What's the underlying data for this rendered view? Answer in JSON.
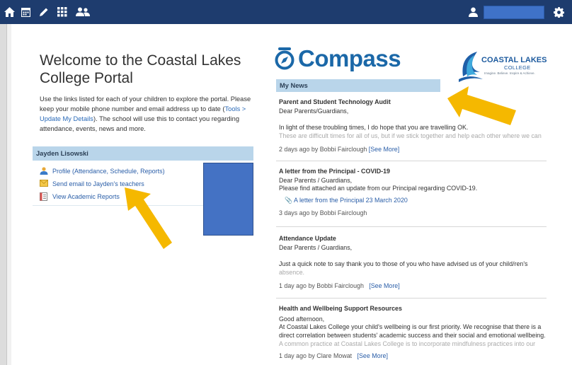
{
  "topbar": {
    "icons": [
      "home-icon",
      "calendar-icon",
      "pencil-icon",
      "grid-icon",
      "people-icon",
      "user-icon",
      "gear-icon"
    ]
  },
  "welcome": {
    "title": "Welcome to the Coastal Lakes College Portal",
    "intro_1": "Use the links listed for each of your children to explore the portal. Please keep your mobile phone number and email address up to date (",
    "intro_link": "Tools > Update My Details",
    "intro_2": "). The school will use this to contact you regarding attendance, events, news and more."
  },
  "student": {
    "name": "Jayden Lisowski",
    "links": [
      {
        "label": "Profile (Attendance, Schedule, Reports)",
        "icon": "profile-icon"
      },
      {
        "label": "Send email to Jayden's teachers",
        "icon": "email-icon"
      },
      {
        "label": "View Academic Reports",
        "icon": "report-icon"
      }
    ]
  },
  "logos": {
    "compass": "Compass",
    "school_name": "COASTAL LAKES",
    "school_sub": "COLLEGE",
    "school_tagline": "Imagine. Believe. Inspire & Achieve."
  },
  "news": {
    "header": "My News",
    "items": [
      {
        "title": "Parent and Student Technology Audit",
        "line1": "Dear Parents/Guardians,",
        "line2": "In light of these troubling times, I do hope that you are travelling OK.",
        "faded": "These are difficult times for all of us, but if we stick together and help each other where we can",
        "meta": "2 days ago by Bobbi Fairclough",
        "more": "[See More]"
      },
      {
        "title": "A letter from the Principal - COVID-19",
        "line1": "Dear Parents / Guardians,",
        "line2": "Please find attached an update from our Principal regarding COVID-19.",
        "attachment": "A letter from the Principal 23 March 2020",
        "meta": "3 days ago by Bobbi Fairclough"
      },
      {
        "title": "Attendance Update",
        "line1": "Dear Parents / Guardians,",
        "line2": "Just a quick note to say thank you to those of you who have advised us of your child/ren's",
        "faded": "absence.",
        "meta": "1 day ago by Bobbi Fairclough",
        "more": "[See More]"
      },
      {
        "title": "Health and Wellbeing Support Resources",
        "line1": "Good afternoon,",
        "line2": "At Coastal Lakes College your child's wellbeing is our first priority. We recognise that there is a direct correlation between students' academic success and their social and emotional wellbeing.",
        "faded": "A common practice at Coastal Lakes College is to incorporate mindfulness practices into our",
        "meta": "1 day ago by Clare Mowat",
        "more": "[See More]"
      }
    ]
  },
  "colors": {
    "topbar": "#1e3c6e",
    "header_bar": "#b9d5ea",
    "link": "#2a5ea8",
    "redaction": "#4472c4",
    "arrow": "#f5b800"
  }
}
